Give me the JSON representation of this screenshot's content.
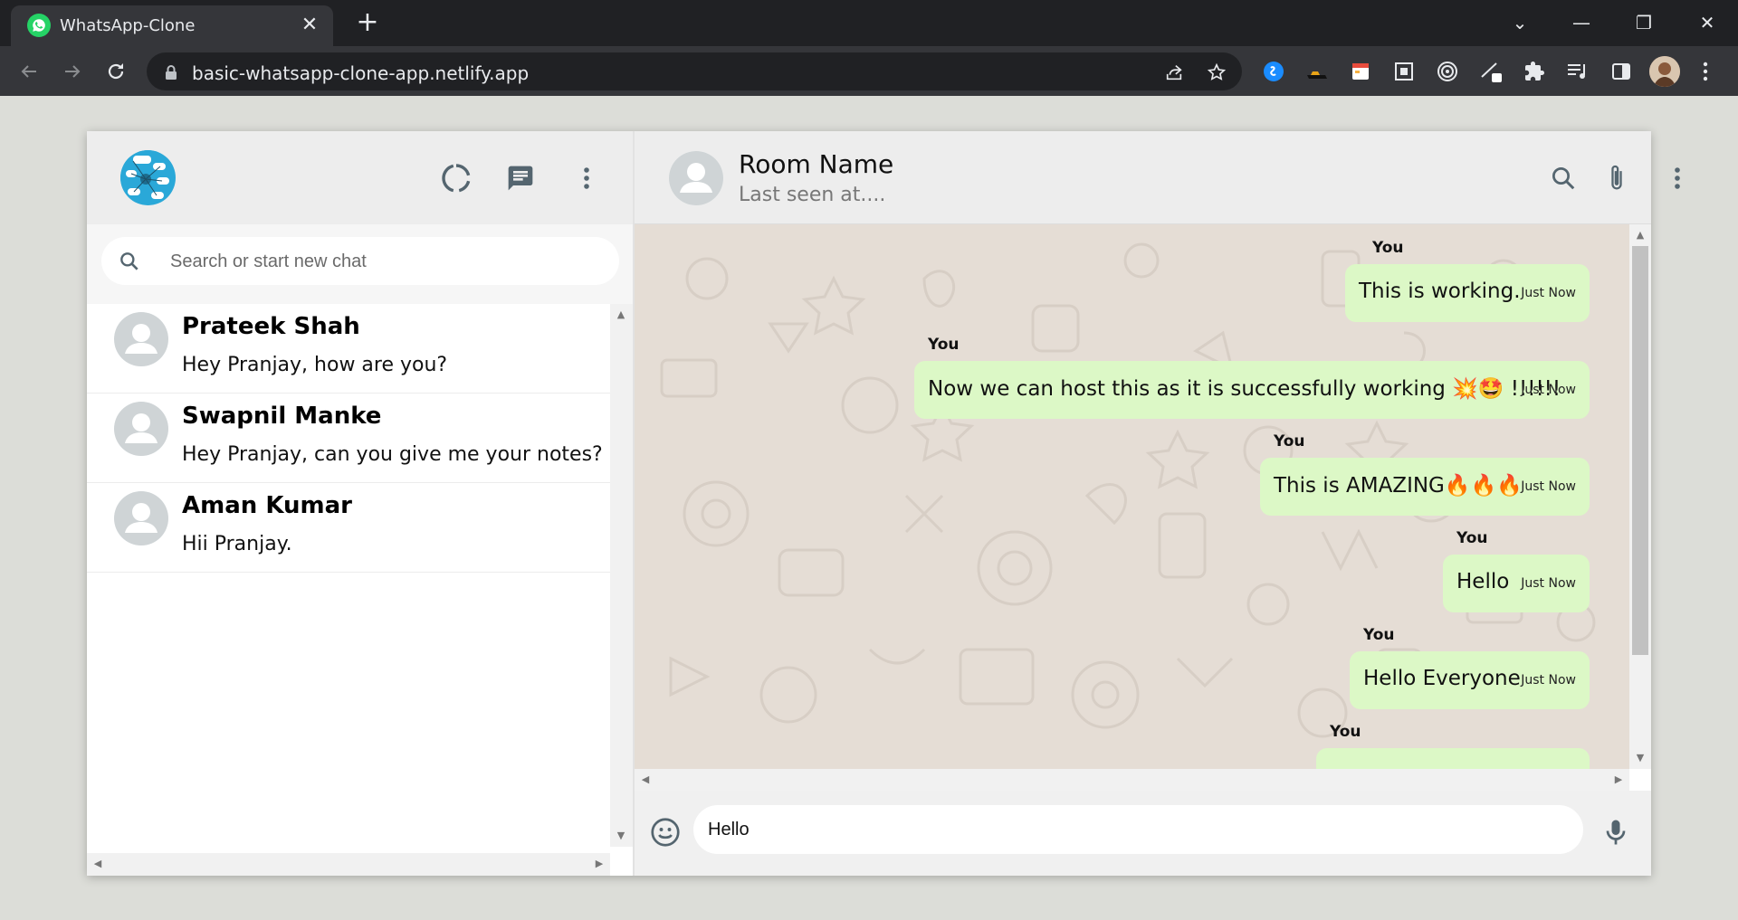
{
  "browser": {
    "tab_title": "WhatsApp-Clone",
    "tab_close": "✕",
    "new_tab": "+",
    "url": "basic-whatsapp-clone-app.netlify.app",
    "window_controls": [
      "⌄",
      "—",
      "❐",
      "✕"
    ]
  },
  "sidebar": {
    "search_placeholder": "Search or start new chat",
    "chats": [
      {
        "name": "Prateek Shah",
        "last_message": "Hey Pranjay, how are you?"
      },
      {
        "name": "Swapnil Manke",
        "last_message": "Hey Pranjay, can you give me your notes?"
      },
      {
        "name": "Aman Kumar",
        "last_message": "Hii Pranjay."
      }
    ]
  },
  "chat": {
    "room_name": "Room Name",
    "room_status": "Last seen at....",
    "messages": [
      {
        "sender": "You",
        "text": "This is working.",
        "time": "Just Now"
      },
      {
        "sender": "You",
        "text": "Now we can host this as it is successfully working 💥🤩 !!!!!!",
        "time": "Just Now"
      },
      {
        "sender": "You",
        "text": "This is AMAZING🔥🔥🔥",
        "time": "Just Now"
      },
      {
        "sender": "You",
        "text": "Hello",
        "time": "Just Now"
      },
      {
        "sender": "You",
        "text": "Hello Everyone",
        "time": "Just Now"
      },
      {
        "sender": "You",
        "text": "",
        "time": ""
      }
    ],
    "input_value": "Hello"
  },
  "colors": {
    "bubble": "#dcf8c6",
    "chat_bg": "#e5ddd5",
    "header": "#ededed",
    "whatsapp_green": "#25d366"
  },
  "icons": [
    "whatsapp-favicon-icon",
    "back-arrow-icon",
    "forward-arrow-icon",
    "reload-icon",
    "lock-icon",
    "share-icon",
    "star-icon",
    "extensions-icon",
    "status-icon",
    "chat-icon",
    "more-vert-icon",
    "search-icon",
    "attach-icon",
    "emoji-icon",
    "mic-icon"
  ]
}
